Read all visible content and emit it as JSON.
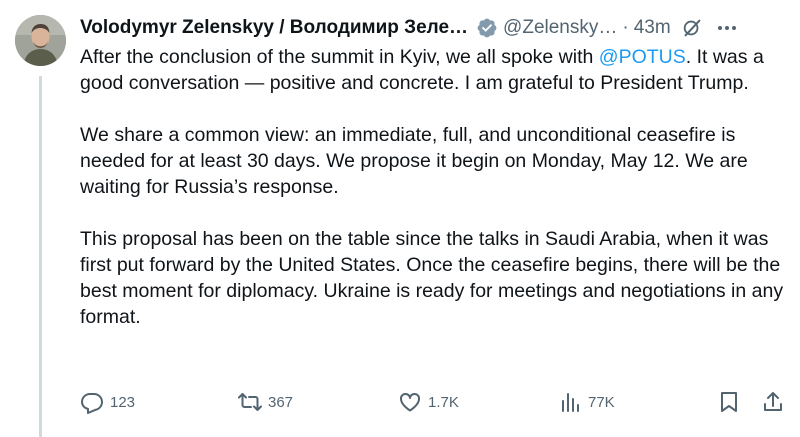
{
  "author": {
    "name": "Volodymyr Zelenskyy / Володимир Зеле…",
    "handle": "@Zelensky…",
    "separator": "·",
    "time": "43m"
  },
  "tweet": {
    "p1_before": "After the conclusion of the summit in Kyiv, we all spoke with ",
    "mention": "@POTUS",
    "p1_after": ". It was a good conversation — positive and concrete. I am grateful to President Trump.",
    "p2": "We share a common view: an immediate, full, and unconditional ceasefire is needed for at least 30 days. We propose it begin on Monday, May 12. We are waiting for Russia’s response.",
    "p3": "This proposal has been on the table since the talks in Saudi Arabia, when it was first put forward by the United States. Once the ceasefire begins, there will be the best moment for diplomacy. Ukraine is ready for meetings and negotiations in any format."
  },
  "actions": {
    "replies": "123",
    "reposts": "367",
    "likes": "1.7K",
    "views": "77K"
  },
  "icons": {
    "reply": "reply-icon",
    "repost": "repost-icon",
    "like": "heart-icon",
    "views": "views-bar-chart-icon",
    "bookmark": "bookmark-icon",
    "share": "share-icon",
    "verified": "verified-badge-icon",
    "grok": "grok-icon",
    "more": "more-dots-icon"
  },
  "colors": {
    "text": "#0f1419",
    "secondary": "#536471",
    "link": "#1d9bf0",
    "thread_line": "#cfd9de"
  }
}
